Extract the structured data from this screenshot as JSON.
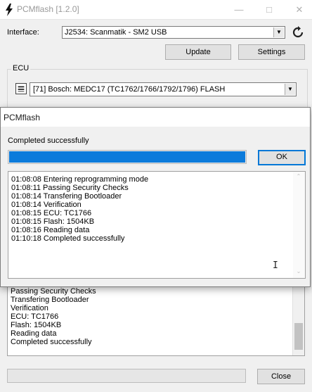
{
  "main_window": {
    "title": "PCMflash [1.2.0]",
    "app_icon": "lightning-icon",
    "controls": {
      "minimize": "□",
      "maximize": "□",
      "close": "✕"
    },
    "interface": {
      "label": "Interface:",
      "value": "J2534: Scanmatik - SM2 USB",
      "dropdown_arrow": "▼"
    },
    "refresh_icon": "refresh-icon",
    "buttons": {
      "update": "Update",
      "settings": "Settings",
      "close": "Close"
    },
    "ecu": {
      "group_label": "ECU",
      "value": "[71] Bosch: MEDC17 (TC1762/1766/1792/1796) FLASH",
      "dropdown_arrow": "▼"
    },
    "log_lines": [
      "Passing Security Checks",
      "Transfering Bootloader",
      "Verification",
      "ECU: TC1766",
      "Flash: 1504KB",
      "Reading data",
      "Completed successfully"
    ]
  },
  "dialog": {
    "title": "PCMflash",
    "status": "Completed successfully",
    "progress_percent": 100,
    "ok_label": "OK",
    "log_lines": [
      "01:08:08 Entering reprogramming mode",
      "01:08:11 Passing Security Checks",
      "01:08:14 Transfering Bootloader",
      "01:08:14 Verification",
      "01:08:15 ECU: TC1766",
      "01:08:15 Flash: 1504KB",
      "01:08:16 Reading data",
      "01:10:18 Completed successfully"
    ],
    "scroll_up": "⌃",
    "scroll_down": "⌄",
    "cursor": "I"
  },
  "colors": {
    "progress_fill": "#0c7bdb",
    "focus_border": "#0078d7"
  }
}
